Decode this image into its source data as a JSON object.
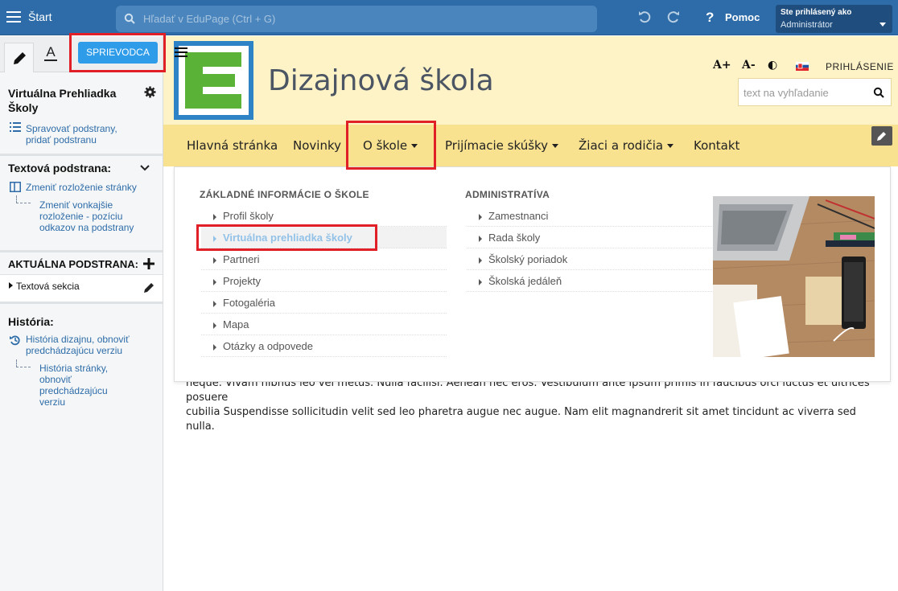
{
  "topbar": {
    "start_label": "Štart",
    "search_placeholder": "Hľadať v EduPage (Ctrl + G)",
    "help_label": "Pomoc",
    "logged_line1": "Ste prihlásený ako",
    "logged_line2": "Administrátor"
  },
  "sidebar": {
    "guide_label": "SPRIEVODCA",
    "tab_text_label": "A",
    "page_title": "Virtuálna Prehliadka Školy",
    "manage_link": "Spravovať podstrany, pridať podstranu",
    "section_text_title": "Textová podstrana:",
    "change_layout_link": "Zmeniť rozloženie stránky",
    "change_outer_layout_link": "Zmeniť vonkajšie rozloženie - pozíciu odkazov na podstrany",
    "current_title": "AKTUÁLNA PODSTRANA:",
    "text_section": "Textová sekcia",
    "history_title": "História:",
    "history_design_link": "História dizajnu, obnoviť predchádzajúcu verziu",
    "history_page_link": "História stránky, obnoviť predchádzajúcu verziu"
  },
  "header": {
    "site_title": "Dizajnová škola",
    "logo_letter": "E",
    "font_plus": "A+",
    "font_minus": "A-",
    "contrast_icon": "◐",
    "login_label": "PRIHLÁSENIE",
    "search_placeholder": "text na vyhľadanie"
  },
  "nav": {
    "items": [
      "Hlavná stránka",
      "Novinky",
      "O škole",
      "Prijímacie skúšky",
      "Žiaci a rodičia",
      "Kontakt"
    ]
  },
  "dropdown": {
    "col1_title": "ZÁKLADNÉ INFORMÁCIE O ŠKOLE",
    "col1_items": [
      "Profil školy",
      "Virtuálna prehliadka školy",
      "Partneri",
      "Projekty",
      "Fotogaléria",
      "Mapa",
      "Otázky a odpovede"
    ],
    "col2_title": "ADMINISTRATÍVA",
    "col2_items": [
      "Zamestnanci",
      "Rada školy",
      "Školský poriadok",
      "Školská jedáleň"
    ]
  },
  "content": {
    "text_line1": "neque. Vivam nibnus leo vel metus. Nulla facilisi. Aenean nec eros. Vestibulum ante ipsum primis in faucibus orci luctus et ultrices posuere",
    "text_line2": "cubilia Suspendisse sollicitudin velit sed leo pharetra augue nec augue. Nam elit magnandrerit sit amet tincidunt ac viverra sed nulla."
  },
  "colors": {
    "topbar": "#2d6ca8",
    "accent_button": "#2e9ce8",
    "header_bg": "#fef3c6",
    "nav_bg": "#f8e290",
    "highlight": "#e11f26",
    "logo_green": "#5ab337"
  }
}
